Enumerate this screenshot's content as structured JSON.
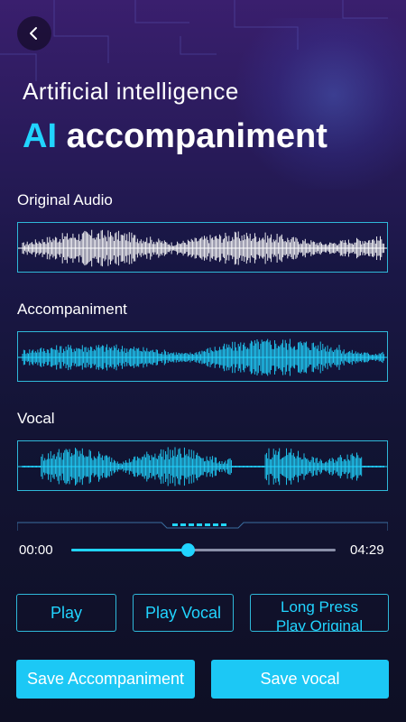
{
  "header": {
    "back_icon": "chevron-left-icon",
    "title_line1": "Artificial intelligence",
    "title_ai": "AI",
    "title_rest": "accompaniment"
  },
  "tracks": [
    {
      "label": "Original Audio",
      "color": "#ffffff"
    },
    {
      "label": "Accompaniment",
      "color": "#21d4ff"
    },
    {
      "label": "Vocal",
      "color": "#21d4ff"
    }
  ],
  "player": {
    "current_time": "00:00",
    "total_time": "04:29",
    "progress": 0.44
  },
  "buttons": {
    "play": "Play",
    "play_vocal": "Play Vocal",
    "play_original_line1": "Long Press",
    "play_original_line2": "Play Original",
    "save_accompaniment": "Save Accompaniment",
    "save_vocal": "Save vocal"
  },
  "colors": {
    "accent": "#21d4ff",
    "button_fill": "#1cc8f5"
  }
}
